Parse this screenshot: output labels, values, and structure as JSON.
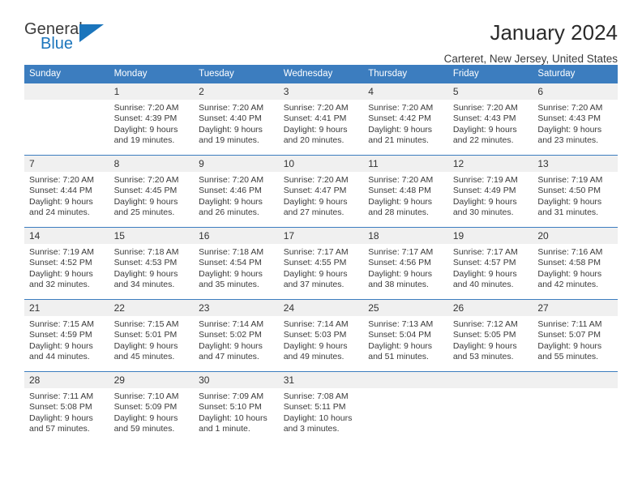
{
  "brand": {
    "word_one": "General",
    "word_two": "Blue",
    "triangle_color": "#1b75bc"
  },
  "header": {
    "title": "January 2024",
    "subtitle": "Carteret, New Jersey, United States"
  },
  "theme": {
    "header_bg": "#3c7dbf",
    "header_text": "#ffffff",
    "daynum_bg": "#f0f0f0",
    "row_border": "#3c7dbf"
  },
  "weekday_headers": [
    "Sunday",
    "Monday",
    "Tuesday",
    "Wednesday",
    "Thursday",
    "Friday",
    "Saturday"
  ],
  "labels": {
    "sunrise_prefix": "Sunrise:",
    "sunset_prefix": "Sunset:",
    "daylight_prefix": "Daylight:"
  },
  "weeks": [
    [
      {
        "day": "",
        "line1": "",
        "line2": "",
        "line3": "",
        "line4": ""
      },
      {
        "day": "1",
        "line1": "Sunrise: 7:20 AM",
        "line2": "Sunset: 4:39 PM",
        "line3": "Daylight: 9 hours",
        "line4": "and 19 minutes."
      },
      {
        "day": "2",
        "line1": "Sunrise: 7:20 AM",
        "line2": "Sunset: 4:40 PM",
        "line3": "Daylight: 9 hours",
        "line4": "and 19 minutes."
      },
      {
        "day": "3",
        "line1": "Sunrise: 7:20 AM",
        "line2": "Sunset: 4:41 PM",
        "line3": "Daylight: 9 hours",
        "line4": "and 20 minutes."
      },
      {
        "day": "4",
        "line1": "Sunrise: 7:20 AM",
        "line2": "Sunset: 4:42 PM",
        "line3": "Daylight: 9 hours",
        "line4": "and 21 minutes."
      },
      {
        "day": "5",
        "line1": "Sunrise: 7:20 AM",
        "line2": "Sunset: 4:43 PM",
        "line3": "Daylight: 9 hours",
        "line4": "and 22 minutes."
      },
      {
        "day": "6",
        "line1": "Sunrise: 7:20 AM",
        "line2": "Sunset: 4:43 PM",
        "line3": "Daylight: 9 hours",
        "line4": "and 23 minutes."
      }
    ],
    [
      {
        "day": "7",
        "line1": "Sunrise: 7:20 AM",
        "line2": "Sunset: 4:44 PM",
        "line3": "Daylight: 9 hours",
        "line4": "and 24 minutes."
      },
      {
        "day": "8",
        "line1": "Sunrise: 7:20 AM",
        "line2": "Sunset: 4:45 PM",
        "line3": "Daylight: 9 hours",
        "line4": "and 25 minutes."
      },
      {
        "day": "9",
        "line1": "Sunrise: 7:20 AM",
        "line2": "Sunset: 4:46 PM",
        "line3": "Daylight: 9 hours",
        "line4": "and 26 minutes."
      },
      {
        "day": "10",
        "line1": "Sunrise: 7:20 AM",
        "line2": "Sunset: 4:47 PM",
        "line3": "Daylight: 9 hours",
        "line4": "and 27 minutes."
      },
      {
        "day": "11",
        "line1": "Sunrise: 7:20 AM",
        "line2": "Sunset: 4:48 PM",
        "line3": "Daylight: 9 hours",
        "line4": "and 28 minutes."
      },
      {
        "day": "12",
        "line1": "Sunrise: 7:19 AM",
        "line2": "Sunset: 4:49 PM",
        "line3": "Daylight: 9 hours",
        "line4": "and 30 minutes."
      },
      {
        "day": "13",
        "line1": "Sunrise: 7:19 AM",
        "line2": "Sunset: 4:50 PM",
        "line3": "Daylight: 9 hours",
        "line4": "and 31 minutes."
      }
    ],
    [
      {
        "day": "14",
        "line1": "Sunrise: 7:19 AM",
        "line2": "Sunset: 4:52 PM",
        "line3": "Daylight: 9 hours",
        "line4": "and 32 minutes."
      },
      {
        "day": "15",
        "line1": "Sunrise: 7:18 AM",
        "line2": "Sunset: 4:53 PM",
        "line3": "Daylight: 9 hours",
        "line4": "and 34 minutes."
      },
      {
        "day": "16",
        "line1": "Sunrise: 7:18 AM",
        "line2": "Sunset: 4:54 PM",
        "line3": "Daylight: 9 hours",
        "line4": "and 35 minutes."
      },
      {
        "day": "17",
        "line1": "Sunrise: 7:17 AM",
        "line2": "Sunset: 4:55 PM",
        "line3": "Daylight: 9 hours",
        "line4": "and 37 minutes."
      },
      {
        "day": "18",
        "line1": "Sunrise: 7:17 AM",
        "line2": "Sunset: 4:56 PM",
        "line3": "Daylight: 9 hours",
        "line4": "and 38 minutes."
      },
      {
        "day": "19",
        "line1": "Sunrise: 7:17 AM",
        "line2": "Sunset: 4:57 PM",
        "line3": "Daylight: 9 hours",
        "line4": "and 40 minutes."
      },
      {
        "day": "20",
        "line1": "Sunrise: 7:16 AM",
        "line2": "Sunset: 4:58 PM",
        "line3": "Daylight: 9 hours",
        "line4": "and 42 minutes."
      }
    ],
    [
      {
        "day": "21",
        "line1": "Sunrise: 7:15 AM",
        "line2": "Sunset: 4:59 PM",
        "line3": "Daylight: 9 hours",
        "line4": "and 44 minutes."
      },
      {
        "day": "22",
        "line1": "Sunrise: 7:15 AM",
        "line2": "Sunset: 5:01 PM",
        "line3": "Daylight: 9 hours",
        "line4": "and 45 minutes."
      },
      {
        "day": "23",
        "line1": "Sunrise: 7:14 AM",
        "line2": "Sunset: 5:02 PM",
        "line3": "Daylight: 9 hours",
        "line4": "and 47 minutes."
      },
      {
        "day": "24",
        "line1": "Sunrise: 7:14 AM",
        "line2": "Sunset: 5:03 PM",
        "line3": "Daylight: 9 hours",
        "line4": "and 49 minutes."
      },
      {
        "day": "25",
        "line1": "Sunrise: 7:13 AM",
        "line2": "Sunset: 5:04 PM",
        "line3": "Daylight: 9 hours",
        "line4": "and 51 minutes."
      },
      {
        "day": "26",
        "line1": "Sunrise: 7:12 AM",
        "line2": "Sunset: 5:05 PM",
        "line3": "Daylight: 9 hours",
        "line4": "and 53 minutes."
      },
      {
        "day": "27",
        "line1": "Sunrise: 7:11 AM",
        "line2": "Sunset: 5:07 PM",
        "line3": "Daylight: 9 hours",
        "line4": "and 55 minutes."
      }
    ],
    [
      {
        "day": "28",
        "line1": "Sunrise: 7:11 AM",
        "line2": "Sunset: 5:08 PM",
        "line3": "Daylight: 9 hours",
        "line4": "and 57 minutes."
      },
      {
        "day": "29",
        "line1": "Sunrise: 7:10 AM",
        "line2": "Sunset: 5:09 PM",
        "line3": "Daylight: 9 hours",
        "line4": "and 59 minutes."
      },
      {
        "day": "30",
        "line1": "Sunrise: 7:09 AM",
        "line2": "Sunset: 5:10 PM",
        "line3": "Daylight: 10 hours",
        "line4": "and 1 minute."
      },
      {
        "day": "31",
        "line1": "Sunrise: 7:08 AM",
        "line2": "Sunset: 5:11 PM",
        "line3": "Daylight: 10 hours",
        "line4": "and 3 minutes."
      },
      {
        "day": "",
        "line1": "",
        "line2": "",
        "line3": "",
        "line4": ""
      },
      {
        "day": "",
        "line1": "",
        "line2": "",
        "line3": "",
        "line4": ""
      },
      {
        "day": "",
        "line1": "",
        "line2": "",
        "line3": "",
        "line4": ""
      }
    ]
  ]
}
